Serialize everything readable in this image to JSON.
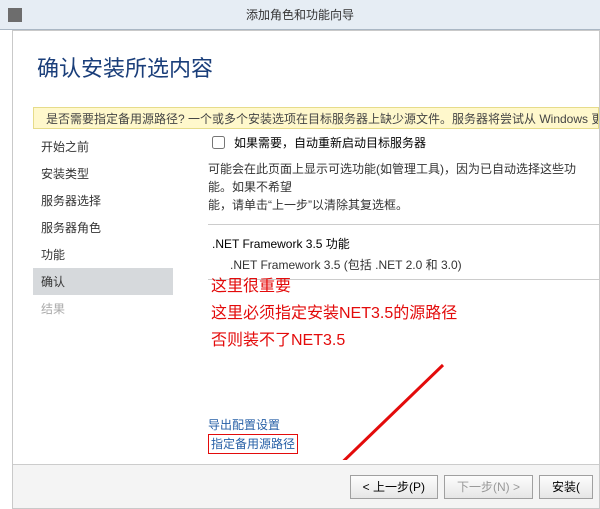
{
  "window": {
    "title": "添加角色和功能向导"
  },
  "page": {
    "title": "确认安装所选内容"
  },
  "warning": {
    "text": "是否需要指定备用源路径? 一个或多个安装选项在目标服务器上缺少源文件。服务器将尝试从 Windows 更新或组策"
  },
  "nav": {
    "items": [
      {
        "label": "开始之前"
      },
      {
        "label": "安装类型"
      },
      {
        "label": "服务器选择"
      },
      {
        "label": "服务器角色"
      },
      {
        "label": "功能"
      },
      {
        "label": "确认",
        "selected": true
      },
      {
        "label": "结果",
        "dim": true
      }
    ]
  },
  "main": {
    "checkbox_label": "如果需要，自动重新启动目标服务器",
    "desc_line1": "可能会在此页面上显示可选功能(如管理工具)，因为已自动选择这些功能。如果不希望",
    "desc_line2": "能，请单击“上一步”以清除其复选框。",
    "feature_title": ".NET Framework 3.5 功能",
    "feature_sub": ".NET Framework 3.5 (包括 .NET 2.0 和 3.0)",
    "link_export": "导出配置设置",
    "link_altpath": "指定备用源路径"
  },
  "annotation": {
    "l1": "这里很重要",
    "l2": "这里必须指定安装NET3.5的源路径",
    "l3": "否则装不了NET3.5"
  },
  "buttons": {
    "prev": "< 上一步(P)",
    "next": "下一步(N) >",
    "install": "安装("
  }
}
